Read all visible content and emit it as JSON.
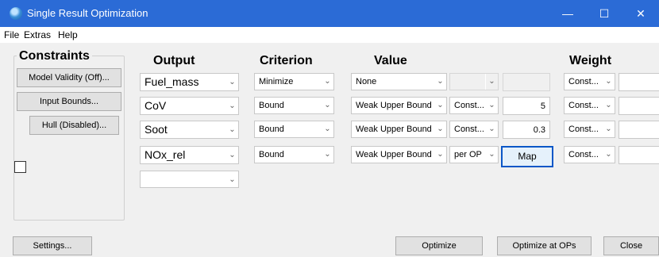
{
  "window": {
    "title": "Single Result Optimization",
    "min_label": "—",
    "max_label": "☐",
    "close_label": "✕"
  },
  "menu": {
    "items": [
      "File",
      "Extras",
      "Help"
    ]
  },
  "constraints": {
    "title": "Constraints",
    "model_validity_label": "Model Validity (Off)...",
    "input_bounds_label": "Input Bounds...",
    "hull_label": "Hull (Disabled)..."
  },
  "columns": {
    "output": "Output",
    "criterion": "Criterion",
    "value": "Value",
    "weight": "Weight"
  },
  "rows": [
    {
      "output": "Fuel_mass",
      "criterion": "Minimize",
      "value_type": "None",
      "value_mode": "",
      "value": "",
      "weight_mode": "Const..."
    },
    {
      "output": "CoV",
      "criterion": "Bound",
      "value_type": "Weak Upper Bound",
      "value_mode": "Const...",
      "value": "5",
      "weight_mode": "Const..."
    },
    {
      "output": "Soot",
      "criterion": "Bound",
      "value_type": "Weak Upper Bound",
      "value_mode": "Const...",
      "value": "0.3",
      "weight_mode": "Const..."
    },
    {
      "output": "NOx_rel",
      "criterion": "Bound",
      "value_type": "Weak Upper Bound",
      "value_mode": "per OP",
      "map_label": "Map",
      "weight_mode": "Const..."
    }
  ],
  "empty_output": "",
  "buttons": {
    "settings": "Settings...",
    "optimize": "Optimize",
    "optimize_at_ops": "Optimize at OPs",
    "close": "Close"
  },
  "icons": {
    "app": "app-globe-icon",
    "dropdown": "chevron-down-icon"
  },
  "colors": {
    "titlebar": "#2b6bd6",
    "focus_border": "#0b57c7"
  }
}
